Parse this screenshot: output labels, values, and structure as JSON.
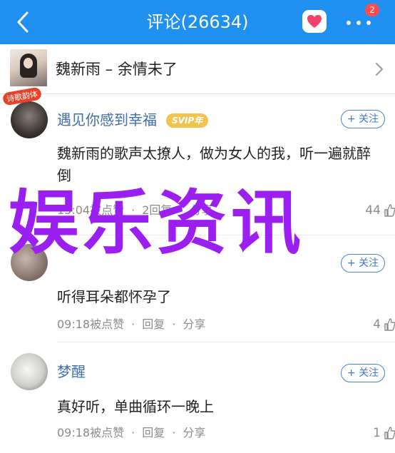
{
  "header": {
    "title": "评论(26634)",
    "back_icon": "chevron-left-icon",
    "heart_icon": "heart-message-icon",
    "more_icon": "more-dots-icon",
    "more_badge": "2"
  },
  "song": {
    "title": "魏新雨 – 余情未了",
    "cover_icon": "album-cover",
    "chevron_icon": "chevron-right-icon"
  },
  "comments": [
    {
      "user": "遇见你感到幸福",
      "vip": "SVIP年",
      "avatar_tag": "诗歌韵体",
      "follow": "+ 关注",
      "text": "魏新雨的歌声太撩人，做为女人的我，听一遍就醉倒",
      "time": "13:04被点赞",
      "reply": "2回复",
      "share": "分享",
      "likes": "44"
    },
    {
      "user": "",
      "follow": "+ 关注",
      "text": "听得耳朵都怀孕了",
      "time": "09:18被点赞",
      "reply": "回复",
      "share": "分享",
      "likes": "4"
    },
    {
      "user": "梦醒",
      "follow": "+ 关注",
      "text": "真好听，单曲循环一晚上",
      "time": "09:18被点赞",
      "reply": "回复",
      "share": "分享",
      "likes": "1"
    }
  ],
  "separator": "·",
  "watermark": "娱乐资讯",
  "colors": {
    "header_bg": "#1f8ff0",
    "username": "#3f6fa8",
    "watermark": "#9b1ff0",
    "svip": "#f0c44f",
    "badge": "#ff4d4f"
  }
}
